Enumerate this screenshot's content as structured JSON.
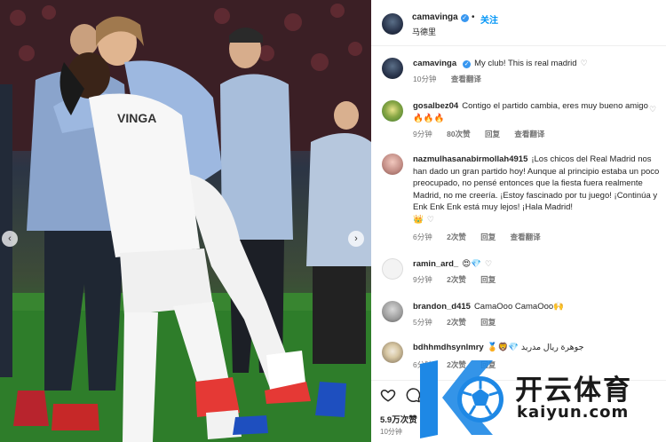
{
  "post": {
    "author": "camavinga",
    "follow_label": "关注",
    "separator": "•",
    "location": "马德里"
  },
  "caption": {
    "author": "camavinga",
    "text": "My club! This is real madrid",
    "time": "10分钟",
    "translate": "查看翻译"
  },
  "comments": [
    {
      "user": "gosalbez04",
      "text": "Contigo el partido cambia, eres muy bueno amigo",
      "emoji": "🔥🔥🔥",
      "time": "9分钟",
      "likes": "80次赞",
      "reply": "回复",
      "translate": "查看翻译"
    },
    {
      "user": "nazmulhasanabirmollah4915",
      "text": "¡Los chicos del Real Madrid nos han dado un gran partido hoy! Aunque al principio estaba un poco preocupado, no pensé entonces que la fiesta fuera realmente Madrid, no me creería. ¡Estoy fascinado por tu juego! ¡Continúa y Enk Enk Enk está muy lejos! ¡Hala Madrid!",
      "emoji": "👑",
      "time": "6分钟",
      "likes": "2次赞",
      "reply": "回复",
      "translate": "查看翻译"
    },
    {
      "user": "ramin_ard_",
      "text": "😍💎",
      "time": "9分钟",
      "likes": "2次赞",
      "reply": "回复"
    },
    {
      "user": "brandon_d415",
      "text": "CamaOoo CamaOoo🙌",
      "time": "5分钟",
      "likes": "2次赞",
      "reply": "回复"
    },
    {
      "user": "bdhhmdhsynlmry",
      "text": "🏅🦁💎 جوهرة ريال مدريد",
      "time": "6分钟",
      "likes": "2次赞",
      "reply": "回复"
    }
  ],
  "footer": {
    "likes": "5.9万次赞",
    "time": "10分钟"
  },
  "watermark": {
    "name": "开云体育",
    "url": "kaiyun.com"
  },
  "colors": {
    "link_blue": "#0095f6",
    "verified_blue": "#3897f0",
    "logo_blue": "#1e88e5",
    "meta_gray": "#737373"
  },
  "icons": [
    "chevron-left-icon",
    "chevron-right-icon",
    "verified-icon",
    "heart-icon",
    "comment-icon",
    "soccer-ball-icon"
  ]
}
